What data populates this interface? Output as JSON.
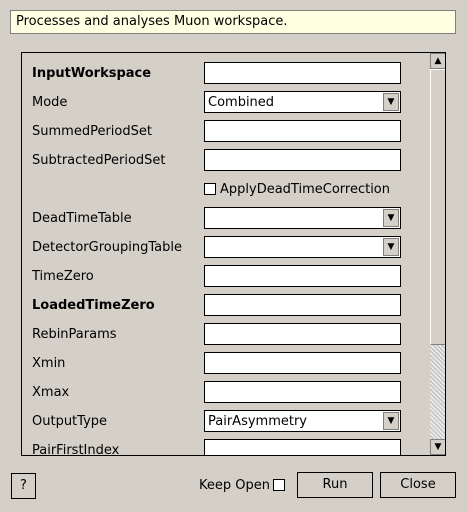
{
  "description": "Processes and analyses Muon workspace.",
  "properties": [
    {
      "label": "InputWorkspace",
      "bold": true,
      "kind": "text",
      "value": ""
    },
    {
      "label": "Mode",
      "bold": false,
      "kind": "combo",
      "value": "Combined"
    },
    {
      "label": "SummedPeriodSet",
      "bold": false,
      "kind": "text",
      "value": ""
    },
    {
      "label": "SubtractedPeriodSet",
      "bold": false,
      "kind": "text",
      "value": ""
    },
    {
      "label": "",
      "bold": false,
      "kind": "check",
      "value": "ApplyDeadTimeCorrection"
    },
    {
      "label": "DeadTimeTable",
      "bold": false,
      "kind": "combo",
      "value": ""
    },
    {
      "label": "DetectorGroupingTable",
      "bold": false,
      "kind": "combo",
      "value": ""
    },
    {
      "label": "TimeZero",
      "bold": false,
      "kind": "text",
      "value": ""
    },
    {
      "label": "LoadedTimeZero",
      "bold": true,
      "kind": "text",
      "value": ""
    },
    {
      "label": "RebinParams",
      "bold": false,
      "kind": "text",
      "value": ""
    },
    {
      "label": "Xmin",
      "bold": false,
      "kind": "text",
      "value": ""
    },
    {
      "label": "Xmax",
      "bold": false,
      "kind": "text",
      "value": ""
    },
    {
      "label": "OutputType",
      "bold": false,
      "kind": "combo",
      "value": "PairAsymmetry"
    },
    {
      "label": "PairFirstIndex",
      "bold": false,
      "kind": "text",
      "value": ""
    }
  ],
  "footer": {
    "help_label": "?",
    "keep_open_label": "Keep Open",
    "run_label": "Run",
    "close_label": "Close"
  }
}
